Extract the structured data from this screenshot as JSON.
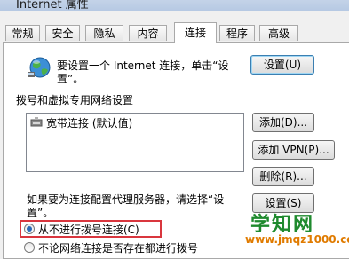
{
  "window": {
    "title": "Internet 属性"
  },
  "tabs": [
    {
      "label": "常规"
    },
    {
      "label": "安全"
    },
    {
      "label": "隐私"
    },
    {
      "label": "内容"
    },
    {
      "label": "连接"
    },
    {
      "label": "程序"
    },
    {
      "label": "高级"
    }
  ],
  "active_tab": "连接",
  "setup": {
    "line1": "要设置一个 Internet 连接，单击“设",
    "line2": "置”。",
    "button": "设置(U)"
  },
  "dialup": {
    "heading": "拨号和虚拟专用网络设置",
    "items": [
      {
        "label": "宽带连接 (默认值)"
      }
    ],
    "add_button": "添加(D)...",
    "add_vpn_button": "添加 VPN(P)...",
    "remove_button": "删除(R)...",
    "proxy_text_line1": "如果要为连接配置代理服务器，请选择“设",
    "proxy_text_line2": "置”。",
    "settings_button": "设置(S)"
  },
  "radios": [
    {
      "label": "从不进行拨号连接(C)",
      "selected": true
    },
    {
      "label": "不论网络连接是否存在都进行拨号",
      "selected": false
    }
  ],
  "watermark": {
    "brand": "学知网",
    "url": "www.jmqz1000.com"
  },
  "colors": {
    "highlight": "#d9363e",
    "watermark_green": "#1f8a2e",
    "watermark_orange": "#e07b00"
  }
}
